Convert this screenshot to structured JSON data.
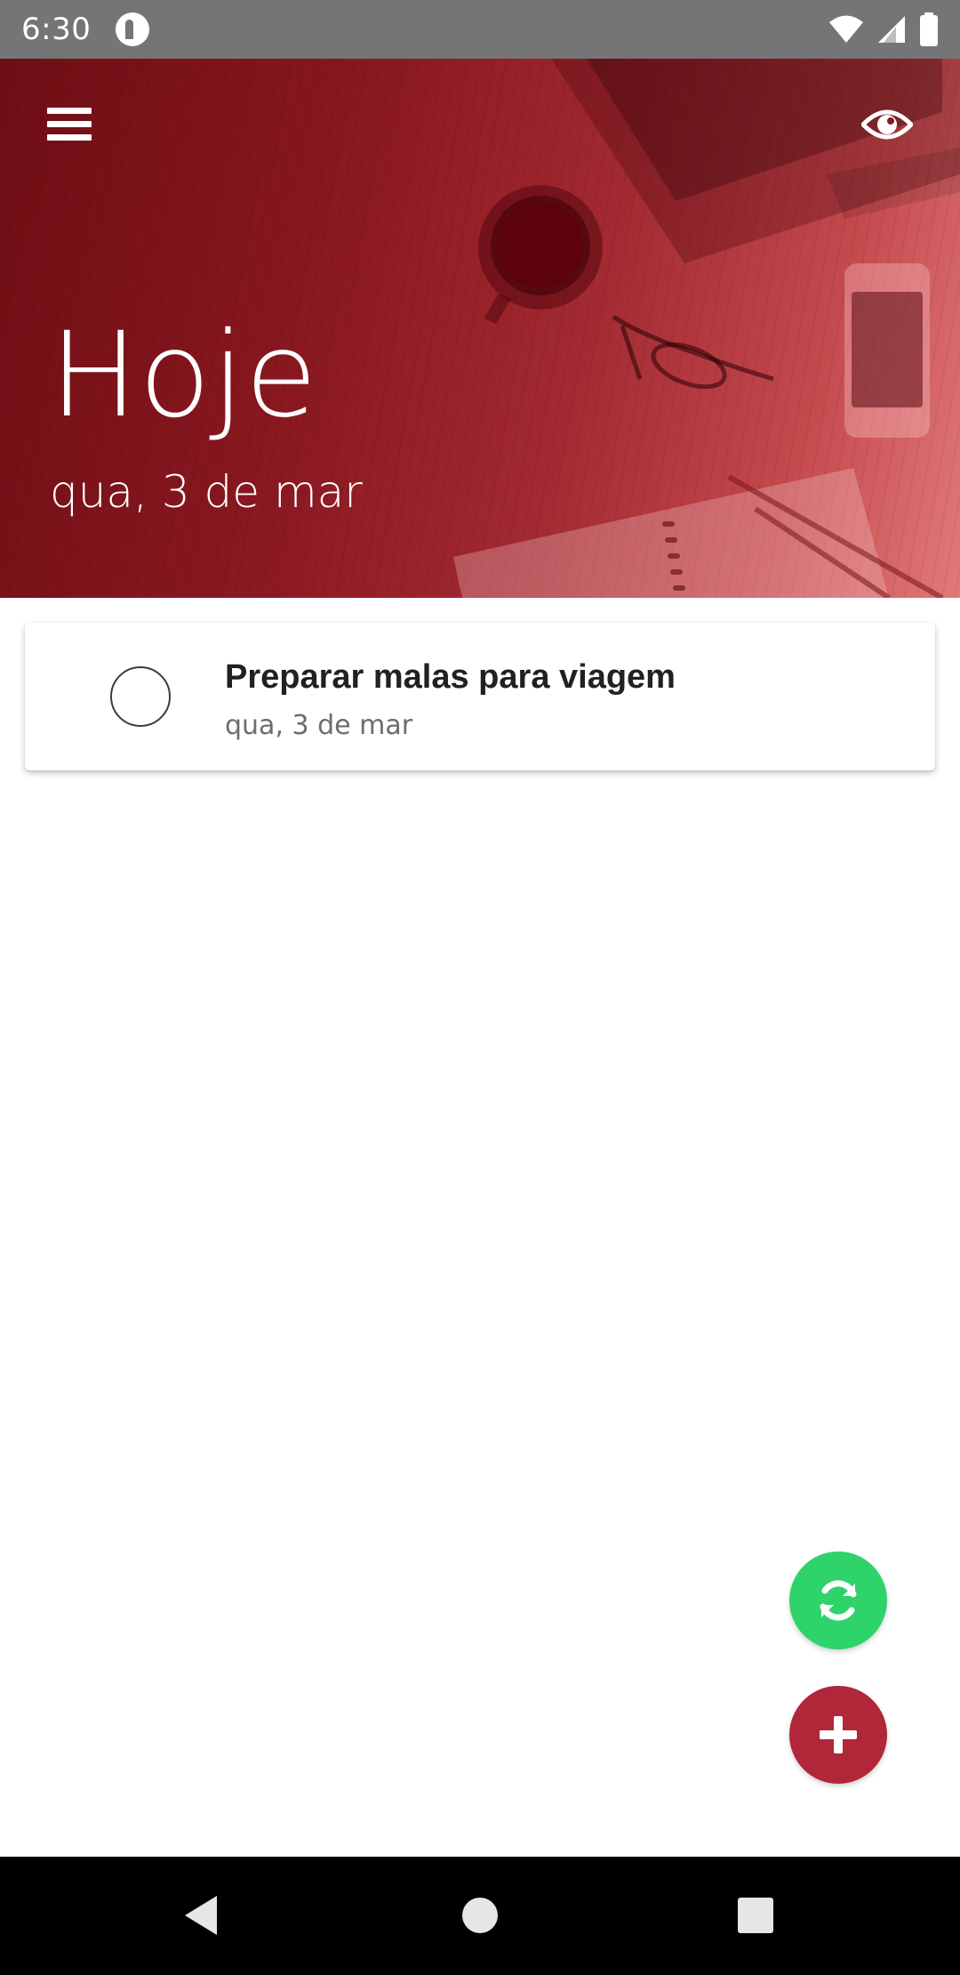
{
  "status_bar": {
    "time": "6:30",
    "icons": [
      "app-notification-icon",
      "wifi-icon",
      "cell-signal-icon",
      "battery-icon"
    ]
  },
  "header": {
    "title": "Hoje",
    "date": "qua, 3 de mar",
    "menu_icon": "hamburger-menu-icon",
    "view_icon": "eye-icon",
    "colors": {
      "dark": "#6e0e14",
      "mid": "#a32a32",
      "light": "#e27a7a"
    }
  },
  "tasks": [
    {
      "title": "Preparar malas para viagem",
      "date": "qua, 3 de mar",
      "completed": false
    }
  ],
  "fabs": {
    "sync": {
      "icon": "sync-icon",
      "color": "#2ed36a"
    },
    "add": {
      "icon": "plus-icon",
      "color": "#b0273a"
    }
  },
  "nav_bar": {
    "icons": [
      "back-icon",
      "home-icon",
      "recents-icon"
    ]
  }
}
